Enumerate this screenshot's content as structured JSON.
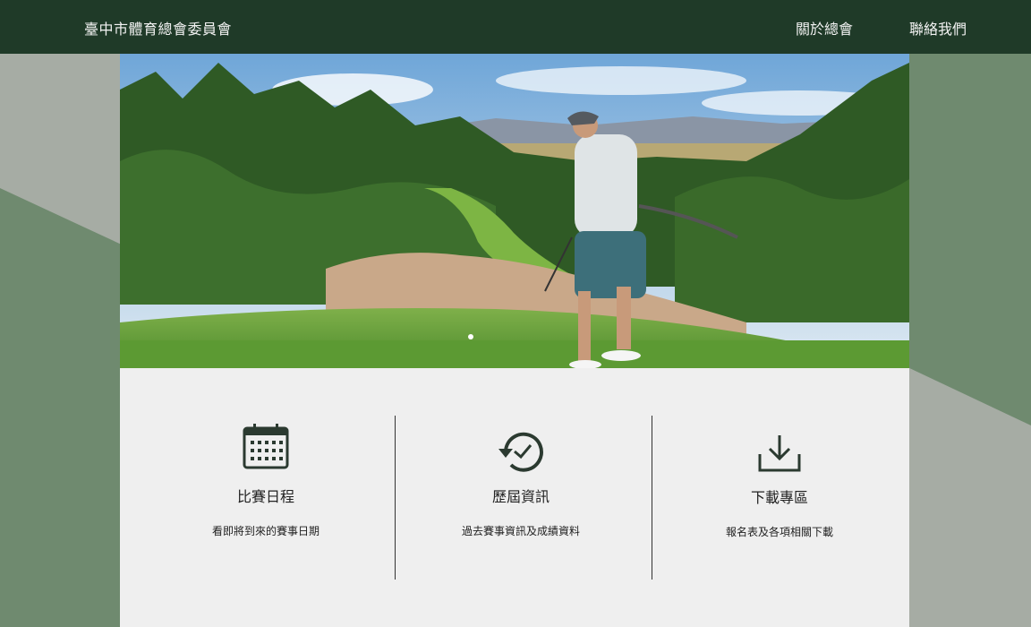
{
  "header": {
    "brand": "臺中市體育總會委員會",
    "nav": [
      {
        "label": "關於總會"
      },
      {
        "label": "聯絡我們"
      }
    ]
  },
  "features": [
    {
      "icon": "calendar-icon",
      "title": "比賽日程",
      "desc": "看即將到來的賽事日期"
    },
    {
      "icon": "history-icon",
      "title": "歷屆資訊",
      "desc": "過去賽事資訊及成績資料"
    },
    {
      "icon": "download-icon",
      "title": "下載專區",
      "desc": "報名表及各項相關下載"
    }
  ],
  "colors": {
    "nav_bg": "#1f3a28",
    "page_bg": "#a6aca4",
    "accent_green": "#6f8a6f",
    "card_bg": "#efefef",
    "icon": "#2b3a30"
  }
}
